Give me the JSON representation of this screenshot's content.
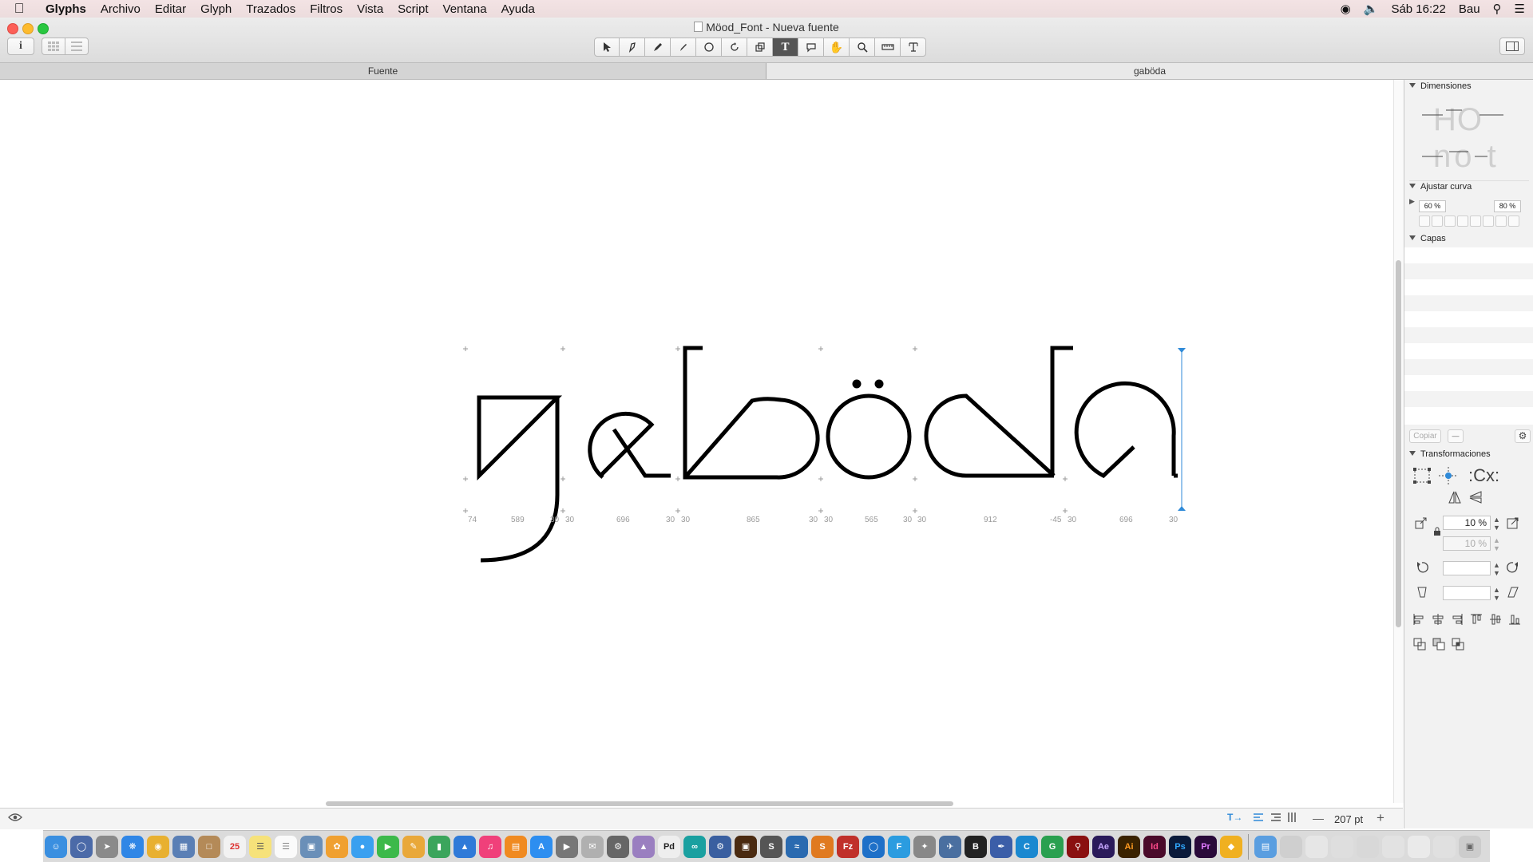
{
  "menubar": {
    "app_name": "Glyphs",
    "items": [
      "Archivo",
      "Editar",
      "Glyph",
      "Trazados",
      "Filtros",
      "Vista",
      "Script",
      "Ventana",
      "Ayuda"
    ],
    "clock": "Sáb 16:22",
    "user": "Bau"
  },
  "window": {
    "title": "Möod_Font - Nueva fuente",
    "info_button": "i"
  },
  "tabs": {
    "font_tab": "Fuente",
    "glyph_tab": "gaböda"
  },
  "canvas": {
    "metrics_labels": [
      "74",
      "589",
      "30",
      "30",
      "696",
      "30",
      "30",
      "865",
      "30",
      "30",
      "565",
      "30",
      "30",
      "912",
      "-45",
      "30",
      "696",
      "30"
    ]
  },
  "panel": {
    "dimensions_title": "Dimensiones",
    "curve_title": "Ajustar curva",
    "curve_min": "60 %",
    "curve_max": "80 %",
    "layers_title": "Capas",
    "copy_label": "Copiar",
    "minus_label": "—",
    "transform_title": "Transformaciones",
    "scale_value": "10 %",
    "scale_value_2": "10 %",
    "dimension_glyphs_a": "HO",
    "dimension_glyphs_b": "no t"
  },
  "bottombar": {
    "zoom": "207 pt"
  },
  "colors": {
    "accent": "#2f8ad8",
    "outline": "#000000"
  }
}
